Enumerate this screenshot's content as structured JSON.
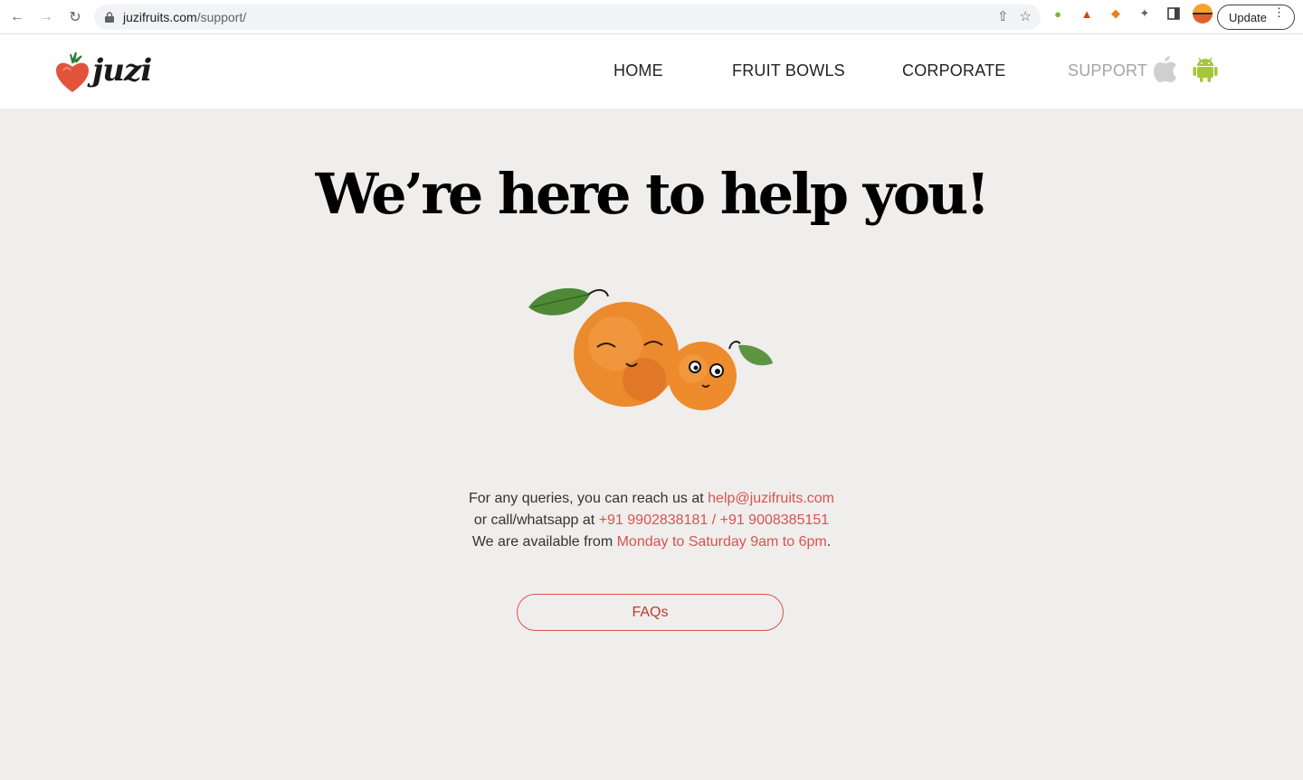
{
  "browser": {
    "url_host": "juzifruits.com",
    "url_path": "/support/",
    "update_label": "Update"
  },
  "header": {
    "logo_text": "juzi",
    "nav": {
      "home": "HOME",
      "fruit_bowls": "FRUIT BOWLS",
      "corporate": "CORPORATE",
      "support": "SUPPORT"
    }
  },
  "main": {
    "title": "We’re here to help you!",
    "line1_prefix": "For any queries, you can reach us at ",
    "email": "help@juzifruits.com",
    "line2_prefix": "or call/whatsapp at ",
    "phones": "+91 9902838181 / +91 9008385151",
    "line3_prefix": "We are available from ",
    "hours": "Monday to Saturday 9am to 6pm",
    "line3_suffix": ".",
    "faq_label": "FAQs"
  },
  "colors": {
    "accent": "#d9534f",
    "page_bg": "#efeeec",
    "nav_muted": "#a4a4a4",
    "android_green": "#a4c639"
  }
}
